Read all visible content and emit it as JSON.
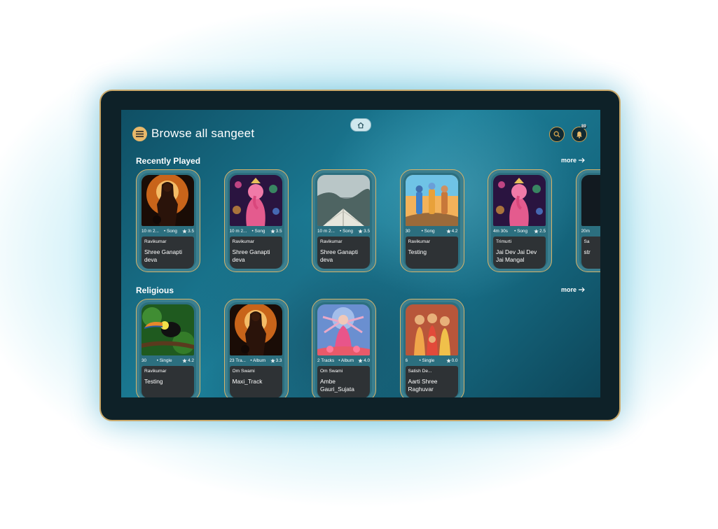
{
  "header": {
    "title": "Browse all sangeet",
    "notification_count": "89"
  },
  "sections": [
    {
      "title": "Recently Played",
      "more_label": "more",
      "cards": [
        {
          "duration": "10 m 2...",
          "type": "Song",
          "rating": "3.5",
          "artist": "Ravikumar",
          "title": "Shree Ganapti deva",
          "thumb": "warrior"
        },
        {
          "duration": "10 m 2...",
          "type": "Song",
          "rating": "3.5",
          "artist": "Ravikumar",
          "title": "Shree Ganapti deva",
          "thumb": "ganesha"
        },
        {
          "duration": "10 m 2...",
          "type": "Song",
          "rating": "3.5",
          "artist": "Ravikumar",
          "title": "Shree Ganapti deva",
          "thumb": "book"
        },
        {
          "duration": "30",
          "type": "Song",
          "rating": "4.2",
          "artist": "Ravikumar",
          "title": "Testing",
          "thumb": "trio"
        },
        {
          "duration": "4m 30s",
          "type": "Song",
          "rating": "2.5",
          "artist": "Trimurti",
          "title": "Jai Dev Jai Dev Jai Mangal",
          "thumb": "ganesha"
        },
        {
          "duration": "20m",
          "type": "",
          "rating": "",
          "artist": "Sa",
          "title": "str",
          "thumb": "dark"
        }
      ]
    },
    {
      "title": "Religious",
      "more_label": "more",
      "cards": [
        {
          "duration": "30",
          "type": "Single",
          "rating": "4.2",
          "artist": "Ravikumar",
          "title": "Testing",
          "thumb": "toucan"
        },
        {
          "duration": "23 Tra...",
          "type": "Album",
          "rating": "3.3",
          "artist": "Om Swami",
          "title": "Maxi_Track",
          "thumb": "warrior"
        },
        {
          "duration": "2 Tracks",
          "type": "Album",
          "rating": "4.0",
          "artist": "Om Swami",
          "title": "Ambe Gauri_Sujata",
          "thumb": "goddess"
        },
        {
          "duration": "6",
          "type": "Single",
          "rating": "0.0",
          "artist": "Satish De...",
          "title": "Aarti Shree Raghuvar",
          "thumb": "family"
        }
      ]
    }
  ],
  "colors": {
    "accent": "#d7a44e",
    "card_border": "#d8b46a",
    "info_bg": "#2e3235"
  },
  "icons": {
    "menu": "menu-icon",
    "home": "home-icon",
    "search": "search-icon",
    "bell": "bell-icon",
    "star": "star-icon",
    "arrow": "arrow-right-icon"
  }
}
